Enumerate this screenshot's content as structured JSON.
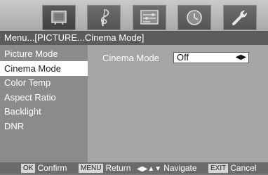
{
  "iconbar": {
    "icons": [
      {
        "name": "picture-icon",
        "selected": true
      },
      {
        "name": "audio-icon",
        "selected": false
      },
      {
        "name": "setup-icon",
        "selected": false
      },
      {
        "name": "timer-icon",
        "selected": false
      },
      {
        "name": "tools-icon",
        "selected": false
      }
    ]
  },
  "breadcrumb": "Menu...[PICTURE...Cinema Mode]",
  "sidebar": {
    "items": [
      {
        "label": "Picture Mode"
      },
      {
        "label": "Cinema Mode"
      },
      {
        "label": "Color Temp"
      },
      {
        "label": "Aspect Ratio"
      },
      {
        "label": "Backlight"
      },
      {
        "label": "DNR"
      }
    ],
    "active": "Cinema Mode"
  },
  "content": {
    "setting_label": "Cinema Mode",
    "setting_value": "Off",
    "value_arrows": "◀▶"
  },
  "helpbar": {
    "ok_key": "OK",
    "ok_label": "Confirm",
    "menu_key": "MENU",
    "menu_label": "Return",
    "nav_icon": "◀▶▲▼",
    "nav_label": "Navigate",
    "exit_key": "EXIT",
    "exit_label": "Cancel"
  },
  "colors": {
    "background": "#b3b3b3",
    "breadcrumb": "#5c5c5c",
    "sidebar": "#8b8b8b",
    "content": "#a5a5a5",
    "selected_item": "#ffffff"
  }
}
